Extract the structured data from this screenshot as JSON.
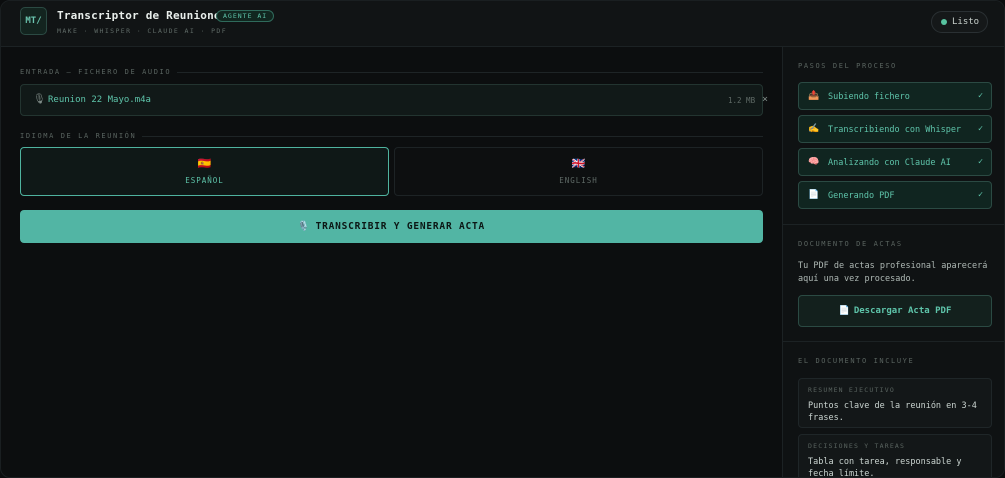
{
  "header": {
    "logo_text": "MT/",
    "title": "Transcriptor de Reuniones",
    "badge": "AGENTE AI",
    "subtitle": "MAKE · WHISPER · CLAUDE AI · PDF",
    "status": "Listo"
  },
  "main": {
    "input_section_label": "ENTRADA — FICHERO DE AUDIO",
    "file": {
      "icon": "microphone-icon",
      "name": "Reunion 22 Mayo.m4a",
      "size": "1.2 MB",
      "remove_glyph": "×"
    },
    "language_section_label": "IDIOMA DE LA REUNIÓN",
    "languages": [
      {
        "flag": "🇪🇸",
        "label": "ESPAÑOL",
        "selected": true
      },
      {
        "flag": "🇬🇧",
        "label": "ENGLISH",
        "selected": false
      }
    ],
    "cta": {
      "icon": "🎙️",
      "label": "TRANSCRIBIR Y GENERAR ACTA"
    }
  },
  "sidebar": {
    "steps_heading": "PASOS DEL PROCESO",
    "steps": [
      {
        "icon": "📤",
        "label": "Subiendo fichero",
        "done": "✓"
      },
      {
        "icon": "✍️",
        "label": "Transcribiendo con Whisper",
        "done": "✓"
      },
      {
        "icon": "🧠",
        "label": "Analizando con Claude AI",
        "done": "✓"
      },
      {
        "icon": "📄",
        "label": "Generando PDF",
        "done": "✓"
      }
    ],
    "document_heading": "DOCUMENTO DE ACTAS",
    "document_desc": "Tu PDF de actas profesional aparecerá aquí una vez procesado.",
    "download": {
      "icon": "📄",
      "label": "Descargar Acta PDF"
    },
    "includes_heading": "EL DOCUMENTO INCLUYE",
    "includes": [
      {
        "title": "RESUMEN EJECUTIVO",
        "text": "Puntos clave de la reunión en 3-4 frases."
      },
      {
        "title": "DECISIONES Y TAREAS",
        "text": "Tabla con tarea, responsable y fecha límite."
      }
    ]
  },
  "colors": {
    "accent": "#52b5a4",
    "accent_text": "#5ec4aa",
    "background": "#0c0e0f",
    "status_dot": "#57c39f"
  }
}
